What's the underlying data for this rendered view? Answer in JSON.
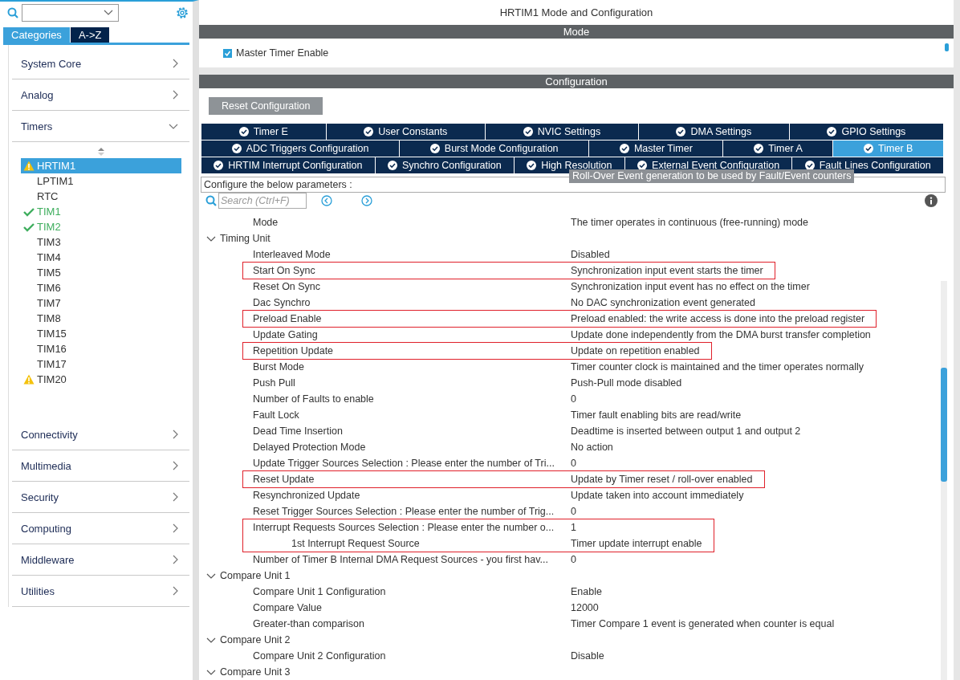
{
  "sidebar": {
    "tabs": [
      {
        "label": "Categories",
        "selected": true
      },
      {
        "label": "A->Z",
        "selected": false
      }
    ],
    "categories": [
      {
        "label": "System Core",
        "expanded": false
      },
      {
        "label": "Analog",
        "expanded": false
      },
      {
        "label": "Timers",
        "expanded": true,
        "children": [
          {
            "label": "HRTIM1",
            "warning": true,
            "configured": false,
            "selected": true
          },
          {
            "label": "LPTIM1",
            "warning": false,
            "configured": false,
            "selected": false
          },
          {
            "label": "RTC",
            "warning": false,
            "configured": false,
            "selected": false
          },
          {
            "label": "TIM1",
            "warning": false,
            "configured": true,
            "selected": false
          },
          {
            "label": "TIM2",
            "warning": false,
            "configured": true,
            "selected": false
          },
          {
            "label": "TIM3",
            "warning": false,
            "configured": false,
            "selected": false
          },
          {
            "label": "TIM4",
            "warning": false,
            "configured": false,
            "selected": false
          },
          {
            "label": "TIM5",
            "warning": false,
            "configured": false,
            "selected": false
          },
          {
            "label": "TIM6",
            "warning": false,
            "configured": false,
            "selected": false
          },
          {
            "label": "TIM7",
            "warning": false,
            "configured": false,
            "selected": false
          },
          {
            "label": "TIM8",
            "warning": false,
            "configured": false,
            "selected": false
          },
          {
            "label": "TIM15",
            "warning": false,
            "configured": false,
            "selected": false
          },
          {
            "label": "TIM16",
            "warning": false,
            "configured": false,
            "selected": false
          },
          {
            "label": "TIM17",
            "warning": false,
            "configured": false,
            "selected": false
          },
          {
            "label": "TIM20",
            "warning": true,
            "configured": false,
            "selected": false
          }
        ]
      },
      {
        "label": "Connectivity",
        "expanded": false
      },
      {
        "label": "Multimedia",
        "expanded": false
      },
      {
        "label": "Security",
        "expanded": false
      },
      {
        "label": "Computing",
        "expanded": false
      },
      {
        "label": "Middleware",
        "expanded": false
      },
      {
        "label": "Utilities",
        "expanded": false
      }
    ]
  },
  "main": {
    "title": "HRTIM1 Mode and Configuration",
    "mode_header": "Mode",
    "master_timer_enable": {
      "label": "Master Timer Enable",
      "checked": true
    },
    "config_header": "Configuration",
    "reset_button": "Reset Configuration",
    "tab_rows": [
      [
        {
          "label": "Timer E",
          "selected": false
        },
        {
          "label": "User Constants",
          "selected": false
        },
        {
          "label": "NVIC Settings",
          "selected": false
        },
        {
          "label": "DMA Settings",
          "selected": false
        },
        {
          "label": "GPIO Settings",
          "selected": false
        }
      ],
      [
        {
          "label": "ADC Triggers Configuration",
          "selected": false
        },
        {
          "label": "Burst Mode Configuration",
          "selected": false
        },
        {
          "label": "Master Timer",
          "selected": false
        },
        {
          "label": "Timer A",
          "selected": false
        },
        {
          "label": "Timer B",
          "selected": true
        }
      ],
      [
        {
          "label": "HRTIM Interrupt Configuration",
          "selected": false
        },
        {
          "label": "Synchro Configuration",
          "selected": false
        },
        {
          "label": "High Resolution",
          "selected": false
        },
        {
          "label": "External Event Configuration",
          "selected": false
        },
        {
          "label": "Fault Lines Configuration",
          "selected": false
        }
      ]
    ],
    "tooltip": "Roll-Over Event generation to be used by Fault/Event counters",
    "configure_label": "Configure the below parameters :",
    "search": {
      "placeholder": "Search (Ctrl+F)"
    },
    "params": [
      {
        "kind": "param",
        "label": "Mode",
        "value": "The timer operates in continuous (free-running) mode",
        "highlighted": false
      },
      {
        "kind": "group",
        "label": "Timing Unit",
        "expanded": true,
        "children": [
          {
            "kind": "param",
            "label": "Interleaved Mode",
            "value": "Disabled",
            "highlighted": false
          },
          {
            "kind": "param",
            "label": "Start On Sync",
            "value": "Synchronization input event starts the timer",
            "highlighted": true
          },
          {
            "kind": "param",
            "label": "Reset On Sync",
            "value": "Synchronization input event has no effect on the timer",
            "highlighted": false
          },
          {
            "kind": "param",
            "label": "Dac Synchro",
            "value": "No DAC synchronization event generated",
            "highlighted": false
          },
          {
            "kind": "param",
            "label": "Preload Enable",
            "value": "Preload enabled: the write access is done into the preload register",
            "highlighted": true
          },
          {
            "kind": "param",
            "label": "Update Gating",
            "value": "Update done independently from the DMA burst transfer completion",
            "highlighted": false
          },
          {
            "kind": "param",
            "label": "Repetition Update",
            "value": "Update on repetition enabled",
            "highlighted": true
          },
          {
            "kind": "param",
            "label": "Burst Mode",
            "value": "Timer counter clock is maintained and the timer operates normally",
            "highlighted": false
          },
          {
            "kind": "param",
            "label": "Push Pull",
            "value": "Push-Pull mode disabled",
            "highlighted": false
          },
          {
            "kind": "param",
            "label": "Number of Faults to enable",
            "value": "0",
            "highlighted": false
          },
          {
            "kind": "param",
            "label": "Fault Lock",
            "value": "Timer fault enabling bits are read/write",
            "highlighted": false
          },
          {
            "kind": "param",
            "label": "Dead Time Insertion",
            "value": "Deadtime is inserted between output 1 and output 2",
            "highlighted": false
          },
          {
            "kind": "param",
            "label": "Delayed Protection Mode",
            "value": "No action",
            "highlighted": false
          },
          {
            "kind": "param",
            "label": "Update Trigger Sources Selection : Please enter the number of Tri...",
            "value": "0",
            "highlighted": false
          },
          {
            "kind": "param",
            "label": "Reset Update",
            "value": "Update by Timer reset / roll-over enabled",
            "highlighted": true
          },
          {
            "kind": "param",
            "label": "Resynchronized Update",
            "value": "Update taken into account immediately",
            "highlighted": false
          },
          {
            "kind": "param",
            "label": "Reset Trigger Sources Selection : Please enter the number of Trig...",
            "value": "0",
            "highlighted": false
          },
          {
            "kind": "param",
            "label": "Interrupt Requests Sources Selection : Please enter the number o...",
            "value": "1",
            "highlighted": true,
            "children": [
              {
                "kind": "param",
                "label": "1st Interrupt Request Source",
                "value": "Timer update interrupt enable",
                "highlighted": false
              }
            ]
          },
          {
            "kind": "param",
            "label": "Number of Timer B Internal DMA Request Sources  - you first hav...",
            "value": "0",
            "highlighted": false
          }
        ]
      },
      {
        "kind": "group",
        "label": "Compare Unit 1",
        "expanded": true,
        "children": [
          {
            "kind": "param",
            "label": "Compare Unit 1 Configuration",
            "value": "Enable",
            "highlighted": false
          },
          {
            "kind": "param",
            "label": "Compare Value",
            "value": "12000",
            "highlighted": false
          },
          {
            "kind": "param",
            "label": "Greater-than comparison",
            "value": "Timer Compare 1 event is generated when counter is equal",
            "highlighted": false
          }
        ]
      },
      {
        "kind": "group",
        "label": "Compare Unit 2",
        "expanded": true,
        "children": [
          {
            "kind": "param",
            "label": "Compare Unit 2 Configuration",
            "value": "Disable",
            "highlighted": false
          }
        ]
      },
      {
        "kind": "group",
        "label": "Compare Unit 3",
        "expanded": true
      }
    ]
  }
}
